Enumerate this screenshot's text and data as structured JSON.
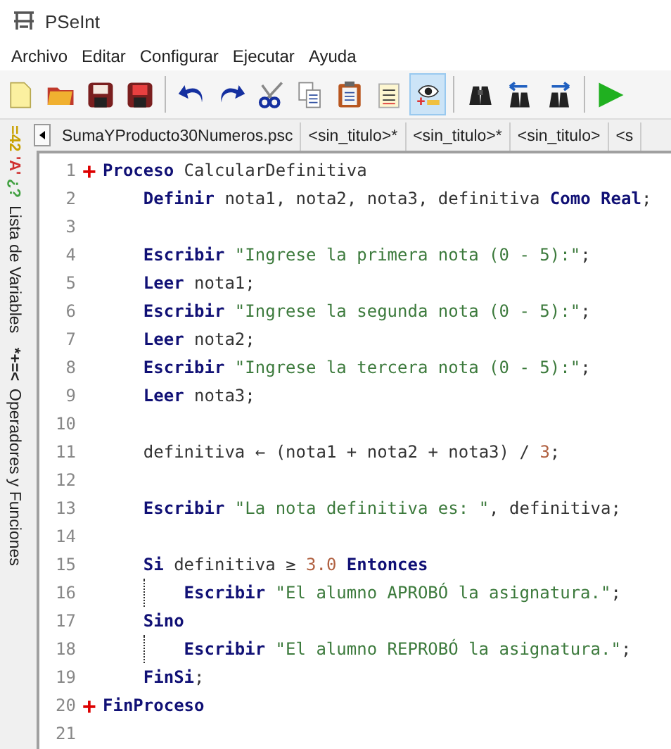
{
  "window": {
    "title": "PSeInt"
  },
  "menu": [
    "Archivo",
    "Editar",
    "Configurar",
    "Ejecutar",
    "Ayuda"
  ],
  "toolbar": [
    {
      "kind": "new",
      "pressed": false
    },
    {
      "kind": "open",
      "pressed": false
    },
    {
      "kind": "save",
      "pressed": false
    },
    {
      "kind": "save-as",
      "pressed": false
    },
    {
      "kind": "sep"
    },
    {
      "kind": "undo",
      "pressed": false
    },
    {
      "kind": "redo",
      "pressed": false
    },
    {
      "kind": "cut",
      "pressed": false
    },
    {
      "kind": "copy",
      "pressed": false
    },
    {
      "kind": "paste",
      "pressed": false
    },
    {
      "kind": "list",
      "pressed": false
    },
    {
      "kind": "watch",
      "pressed": true
    },
    {
      "kind": "sep"
    },
    {
      "kind": "find",
      "pressed": false
    },
    {
      "kind": "find-prev",
      "pressed": false
    },
    {
      "kind": "find-next",
      "pressed": false
    },
    {
      "kind": "sep"
    },
    {
      "kind": "run",
      "pressed": false
    }
  ],
  "side_panels": [
    {
      "glyphs": [
        {
          "text": "=42",
          "color": "#c8a000"
        },
        {
          "text": "'A'",
          "color": "#d03030"
        },
        {
          "text": "¿?",
          "color": "#40a040"
        }
      ],
      "label": "Lista de Variables"
    },
    {
      "glyphs": [
        {
          "text": "*+=<",
          "color": "#222222"
        }
      ],
      "label": "Operadores y Funciones"
    }
  ],
  "tabs": [
    {
      "label": "SumaYProducto30Numeros.psc"
    },
    {
      "label": "<sin_titulo>*"
    },
    {
      "label": "<sin_titulo>*"
    },
    {
      "label": "<sin_titulo>"
    },
    {
      "label": "<s"
    }
  ],
  "editor": {
    "lines": [
      {
        "number": "1",
        "marker": "+",
        "tokens": [
          {
            "kind": "kw",
            "text": "Proceso"
          },
          {
            "kind": "id",
            "text": " CalcularDefinitiva"
          }
        ]
      },
      {
        "number": "2",
        "tokens": [
          {
            "kind": "kw",
            "text": "    Definir"
          },
          {
            "kind": "id",
            "text": " nota1, nota2, nota3, definitiva "
          },
          {
            "kind": "kw",
            "text": "Como Real"
          },
          {
            "kind": "id",
            "text": ";"
          }
        ]
      },
      {
        "number": "3"
      },
      {
        "number": "4",
        "tokens": [
          {
            "kind": "kw",
            "text": "    Escribir"
          },
          {
            "kind": "str",
            "text": " \"Ingrese la primera nota (0 - 5):\""
          },
          {
            "kind": "id",
            "text": ";"
          }
        ]
      },
      {
        "number": "5",
        "tokens": [
          {
            "kind": "kw",
            "text": "    Leer"
          },
          {
            "kind": "id",
            "text": " nota1;"
          }
        ]
      },
      {
        "number": "6",
        "tokens": [
          {
            "kind": "kw",
            "text": "    Escribir"
          },
          {
            "kind": "str",
            "text": " \"Ingrese la segunda nota (0 - 5):\""
          },
          {
            "kind": "id",
            "text": ";"
          }
        ]
      },
      {
        "number": "7",
        "tokens": [
          {
            "kind": "kw",
            "text": "    Leer"
          },
          {
            "kind": "id",
            "text": " nota2;"
          }
        ]
      },
      {
        "number": "8",
        "tokens": [
          {
            "kind": "kw",
            "text": "    Escribir"
          },
          {
            "kind": "str",
            "text": " \"Ingrese la tercera nota (0 - 5):\""
          },
          {
            "kind": "id",
            "text": ";"
          }
        ]
      },
      {
        "number": "9",
        "tokens": [
          {
            "kind": "kw",
            "text": "    Leer"
          },
          {
            "kind": "id",
            "text": " nota3;"
          }
        ]
      },
      {
        "number": "10"
      },
      {
        "number": "11",
        "tokens": [
          {
            "kind": "id",
            "text": "    definitiva "
          },
          {
            "kind": "op",
            "text": "←"
          },
          {
            "kind": "id",
            "text": " (nota1 + nota2 + nota3) / "
          },
          {
            "kind": "num",
            "text": "3"
          },
          {
            "kind": "id",
            "text": ";"
          }
        ]
      },
      {
        "number": "12"
      },
      {
        "number": "13",
        "tokens": [
          {
            "kind": "kw",
            "text": "    Escribir"
          },
          {
            "kind": "str",
            "text": " \"La nota definitiva es: \""
          },
          {
            "kind": "id",
            "text": ", definitiva;"
          }
        ]
      },
      {
        "number": "14"
      },
      {
        "number": "15",
        "tokens": [
          {
            "kind": "kw",
            "text": "    Si"
          },
          {
            "kind": "id",
            "text": " definitiva "
          },
          {
            "kind": "op",
            "text": "≥"
          },
          {
            "kind": "num",
            "text": " 3.0"
          },
          {
            "kind": "kw",
            "text": " Entonces"
          }
        ]
      },
      {
        "number": "16",
        "guide": true,
        "tokens": [
          {
            "kind": "kw",
            "text": "Escribir"
          },
          {
            "kind": "str",
            "text": " \"El alumno APROBÓ la asignatura.\""
          },
          {
            "kind": "id",
            "text": ";"
          }
        ]
      },
      {
        "number": "17",
        "tokens": [
          {
            "kind": "kw",
            "text": "    Sino"
          }
        ]
      },
      {
        "number": "18",
        "guide": true,
        "tokens": [
          {
            "kind": "kw",
            "text": "Escribir"
          },
          {
            "kind": "str",
            "text": " \"El alumno REPROBÓ la asignatura.\""
          },
          {
            "kind": "id",
            "text": ";"
          }
        ]
      },
      {
        "number": "19",
        "tokens": [
          {
            "kind": "kw",
            "text": "    FinSi"
          },
          {
            "kind": "id",
            "text": ";"
          }
        ]
      },
      {
        "number": "20",
        "marker": "+",
        "tokens": [
          {
            "kind": "kw",
            "text": "FinProceso"
          }
        ]
      },
      {
        "number": "21"
      }
    ]
  }
}
